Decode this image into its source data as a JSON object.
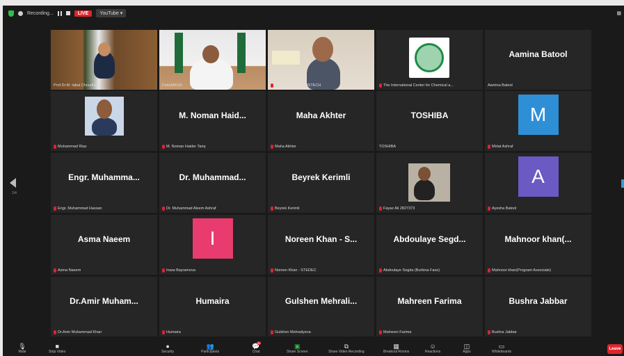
{
  "topbar": {
    "recording": "Recording...",
    "live": "LIVE",
    "youtube": "YouTube ▾"
  },
  "nav": {
    "page": "1/4"
  },
  "tiles": [
    {
      "name": "Prof.Dr.M. Iqbal Choudhary",
      "mute": false
    },
    {
      "name": "PattaMKHS",
      "mute": false
    },
    {
      "name": "Elahan Sabri- COMSTECH",
      "mute": true
    },
    {
      "name": "The International Center for Chemical a...",
      "mute": true
    },
    {
      "big": "Aamina Batool",
      "name": "Aamina Batool",
      "mute": false
    },
    {
      "name": "Muhammad Riaz",
      "mute": true
    },
    {
      "big": "M. Noman Haid...",
      "name": "M. Noman Haider Tariq",
      "mute": true
    },
    {
      "big": "Maha Akhter",
      "name": "Maha Akhter",
      "mute": true
    },
    {
      "big": "TOSHIBA",
      "name": "TOSHIBA",
      "mute": false
    },
    {
      "avatar": "M",
      "avatar_color": "#2f8fd6",
      "name": "Mirlat Ashraf",
      "mute": true
    },
    {
      "big": "Engr. Muhamma...",
      "name": "Engr. Muhammad Hassan",
      "mute": true
    },
    {
      "big": "Dr. Muhammad...",
      "name": "Dr. Muhammad Aleem Ashraf",
      "mute": true
    },
    {
      "big": "Beyrek Kerimli",
      "name": "Beyrek Kerimli",
      "mute": true
    },
    {
      "name": "Fayaz Ali 2827373",
      "mute": true
    },
    {
      "avatar": "A",
      "avatar_color": "#6b59c4",
      "name": "Ayesha Batool",
      "mute": true
    },
    {
      "big": "Asma Naeem",
      "name": "Asma Naeem",
      "mute": true
    },
    {
      "avatar": "I",
      "avatar_color": "#e83b6e",
      "name": "Inara Bayramova",
      "mute": true
    },
    {
      "big": "Noreen Khan - S...",
      "name": "Noreen Khan - STEDEC",
      "mute": true
    },
    {
      "big": "Abdoulaye Segd...",
      "name": "Abdoulaye Segda (Burkina Faso)",
      "mute": true
    },
    {
      "big": "Mahnoor khan(...",
      "name": "Mahnoor khan(Program Associate)",
      "mute": true
    },
    {
      "big": "Dr.Amir Muham...",
      "name": "Dr.Amir Muhammad Khan",
      "mute": true
    },
    {
      "big": "Humaira",
      "name": "Humaira",
      "mute": true
    },
    {
      "big": "Gulshen Mehrali...",
      "name": "Gulshen Mehraliyeva",
      "mute": true
    },
    {
      "big": "Mahreen Farima",
      "name": "Mahreen Farima",
      "mute": true
    },
    {
      "big": "Bushra Jabbar",
      "name": "Bushra Jabbar",
      "mute": true
    }
  ],
  "toolbar": {
    "mute": "Mute",
    "stop_video": "Stop Video",
    "security": "Security",
    "participants": "Participants",
    "participants_count": "77",
    "chat": "Chat",
    "chat_badge": "99",
    "share_screen": "Share Screen",
    "share_video": "Share Video Recording",
    "breakout": "Breakout Rooms",
    "reactions": "Reactions",
    "apps": "Apps",
    "whiteboards": "Whiteboards",
    "leave": "Leave"
  },
  "colors": {
    "live": "#e0242b",
    "active_speaker": "#d9c84a",
    "mute": "#e0242b"
  }
}
